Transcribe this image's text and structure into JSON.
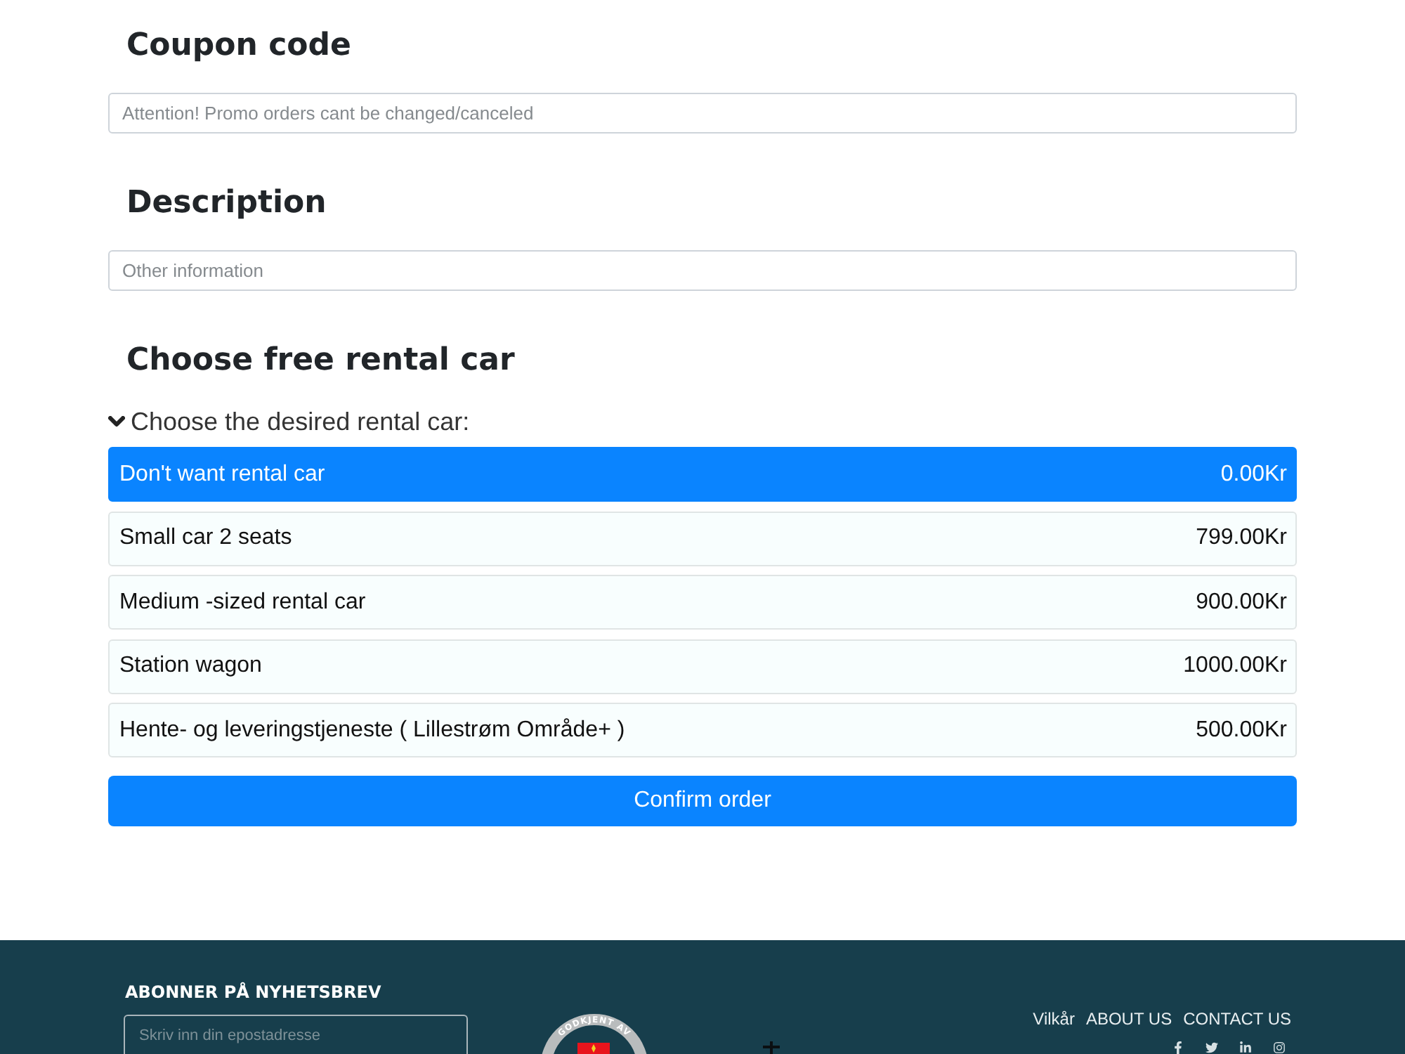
{
  "sections": [
    {
      "kind": "field",
      "heading": "Coupon code",
      "placeholder": "Attention! Promo orders cant be changed/canceled"
    },
    {
      "kind": "field",
      "heading": "Description",
      "placeholder": "Other information"
    },
    {
      "kind": "choice",
      "heading": "Choose free rental car",
      "toggle": {
        "label": "Choose the desired rental car:",
        "expanded": true
      },
      "options": [
        {
          "label": "Don't want rental car",
          "price": "0.00Kr",
          "selected": true
        },
        {
          "label": "Small car 2 seats",
          "price": "799.00Kr",
          "selected": false
        },
        {
          "label": "Medium -sized rental car",
          "price": "900.00Kr",
          "selected": false
        },
        {
          "label": "Station wagon",
          "price": "1000.00Kr",
          "selected": false
        },
        {
          "label": "Hente- og leveringstjeneste ( Lillestrøm Område+ )",
          "price": "500.00Kr",
          "selected": false
        }
      ]
    }
  ],
  "confirm_button": "Confirm order",
  "footer": {
    "newsletter": {
      "title": "ABONNER PÅ NYHETSBREV",
      "placeholder": "Skriv inn din epostadresse"
    },
    "seal_text": "GODKJENT AV",
    "links": [
      "Vilkår",
      "ABOUT US",
      "CONTACT US"
    ]
  }
}
